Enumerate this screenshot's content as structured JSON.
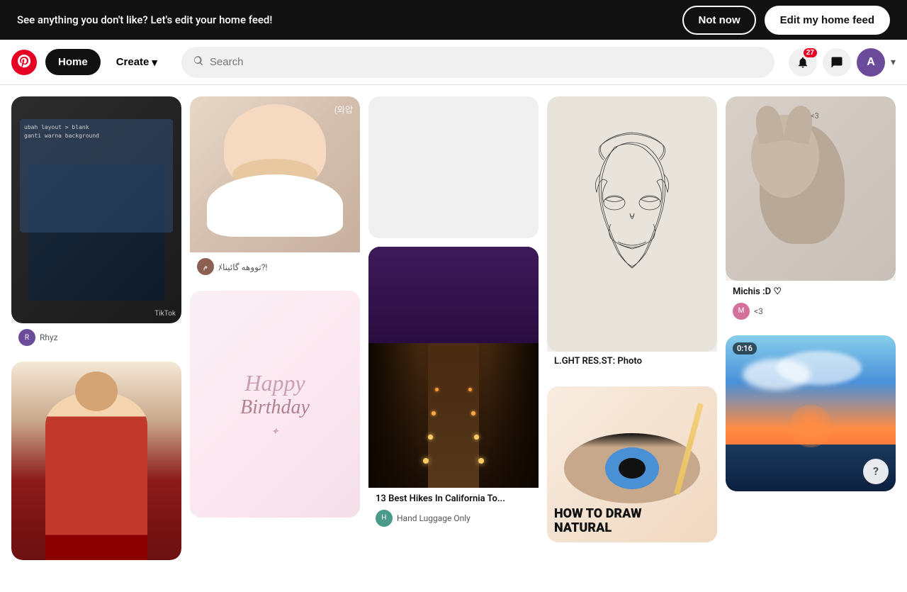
{
  "banner": {
    "text": "See anything you don't like? Let's edit your home feed!",
    "not_now": "Not now",
    "edit_feed": "Edit my home feed"
  },
  "navbar": {
    "home_label": "Home",
    "create_label": "Create",
    "search_placeholder": "Search",
    "notification_count": "27",
    "avatar_letter": "A"
  },
  "pins": [
    {
      "id": "pin-1",
      "type": "image",
      "card_class": "card-1",
      "author": "Rhyz",
      "author_av_class": "av-purple",
      "has_title": false,
      "overlay_text": "ubah layout > blank\nganti warna background",
      "tiktok": true
    },
    {
      "id": "pin-2",
      "type": "image",
      "card_class": "card-2",
      "author": "ﾒﺗﻮﻭﻫﻪ ﮔﺎﺋﯿﻨﺎ?!",
      "author_av_class": "av-brown",
      "has_title": false,
      "overlay_text": "(와압",
      "tiktok": false
    },
    {
      "id": "pin-3",
      "type": "image",
      "card_class": "card-3",
      "author": "Hand Luggage Only",
      "author_av_class": "av-teal",
      "title": "13 Best Hikes In California To...",
      "has_title": true,
      "tiktok": false
    },
    {
      "id": "pin-4",
      "type": "image",
      "card_class": "card-4",
      "title": "L.GHT RES.ST: Photo",
      "has_title": true,
      "tiktok": false
    },
    {
      "id": "pin-5",
      "type": "image",
      "card_class": "card-5",
      "title": "Michis :D ♡",
      "author": "<3",
      "author_av_class": "av-pink",
      "has_title": true,
      "tiktok": false
    },
    {
      "id": "pin-6",
      "type": "image",
      "card_class": "card-6",
      "has_title": false,
      "tiktok": false
    },
    {
      "id": "pin-7",
      "type": "image",
      "card_class": "card-7",
      "has_title": false,
      "tiktok": false
    },
    {
      "id": "pin-8",
      "type": "image",
      "card_class": "card-8",
      "has_title": false,
      "tiktok": false
    },
    {
      "id": "pin-9",
      "type": "video",
      "card_class": "card-9",
      "video_time": "0:16",
      "has_title": false,
      "tiktok": false
    }
  ]
}
